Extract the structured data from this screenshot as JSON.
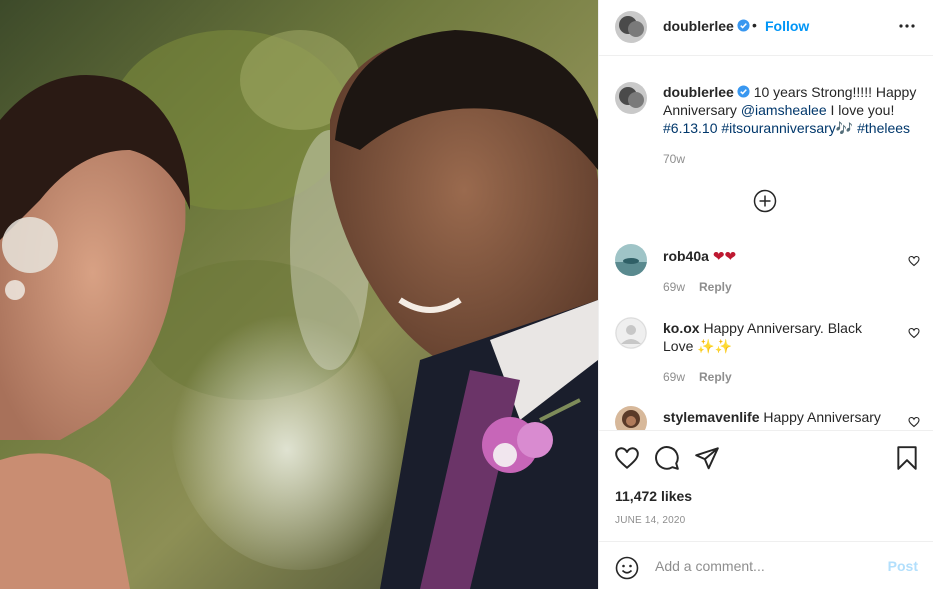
{
  "header": {
    "username": "doublerlee",
    "separator": "•",
    "follow_label": "Follow"
  },
  "caption": {
    "username": "doublerlee",
    "text_plain": "10 years Strong!!!!! Happy Anniversary ",
    "mention": "@iamshealee",
    "text_after": " I love you! ",
    "hashtag1": "#6.13.10",
    "hashtag2": "#itsouranniversary",
    "music_emoji": "🎶",
    "hashtag3": "#thelees",
    "time": "70w"
  },
  "comments": [
    {
      "username": "rob40a",
      "text": "❤❤",
      "time": "69w",
      "reply_label": "Reply"
    },
    {
      "username": "ko.ox",
      "text": "Happy Anniversary. Black Love ✨✨",
      "time": "69w",
      "reply_label": "Reply"
    },
    {
      "username": "stylemavenlife",
      "text": "Happy Anniversary"
    }
  ],
  "actions": {
    "likes": "11,472 likes",
    "date": "JUNE 14, 2020"
  },
  "add_comment": {
    "placeholder": "Add a comment...",
    "post_label": "Post"
  },
  "colors": {
    "accent": "#0095f6",
    "verified": "#3897f0",
    "link": "#00376b",
    "muted": "#8e8e8e",
    "post_disabled": "#b2dffc",
    "heart_emoji": "#be1931"
  },
  "icons": [
    "verified-badge-icon",
    "more-options-icon",
    "load-more-comments-icon",
    "heart-outline-icon",
    "comment-icon",
    "share-icon",
    "bookmark-icon",
    "emoji-icon"
  ]
}
